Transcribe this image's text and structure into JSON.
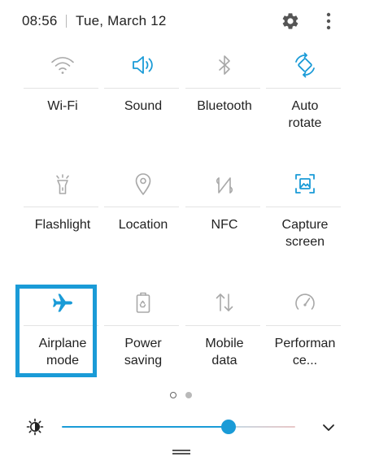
{
  "status": {
    "time": "08:56",
    "date": "Tue, March 12"
  },
  "header": {
    "settings_icon": "gear-icon",
    "more_icon": "more-vert-icon"
  },
  "tiles": [
    {
      "label": "Wi-Fi",
      "icon": "wifi-icon",
      "active": false
    },
    {
      "label": "Sound",
      "icon": "sound-icon",
      "active": true
    },
    {
      "label": "Bluetooth",
      "icon": "bluetooth-icon",
      "active": false
    },
    {
      "label": "Auto\nrotate",
      "icon": "auto-rotate-icon",
      "active": true
    },
    {
      "label": "Flashlight",
      "icon": "flashlight-icon",
      "active": false
    },
    {
      "label": "Location",
      "icon": "location-icon",
      "active": false
    },
    {
      "label": "NFC",
      "icon": "nfc-icon",
      "active": false
    },
    {
      "label": "Capture\nscreen",
      "icon": "capture-screen-icon",
      "active": true
    },
    {
      "label": "Airplane\nmode",
      "icon": "airplane-icon",
      "active": true
    },
    {
      "label": "Power\nsaving",
      "icon": "power-saving-icon",
      "active": false
    },
    {
      "label": "Mobile\ndata",
      "icon": "mobile-data-icon",
      "active": false
    },
    {
      "label": "Performan\nce...",
      "icon": "performance-icon",
      "active": false
    }
  ],
  "pages": {
    "count": 2,
    "current": 1
  },
  "brightness": {
    "level": 0.715,
    "icon": "brightness-icon",
    "expand_icon": "chevron-down-icon"
  },
  "colors": {
    "accent": "#1a9bd7",
    "inactive_icon": "#9a9a9a",
    "text": "#222222"
  }
}
